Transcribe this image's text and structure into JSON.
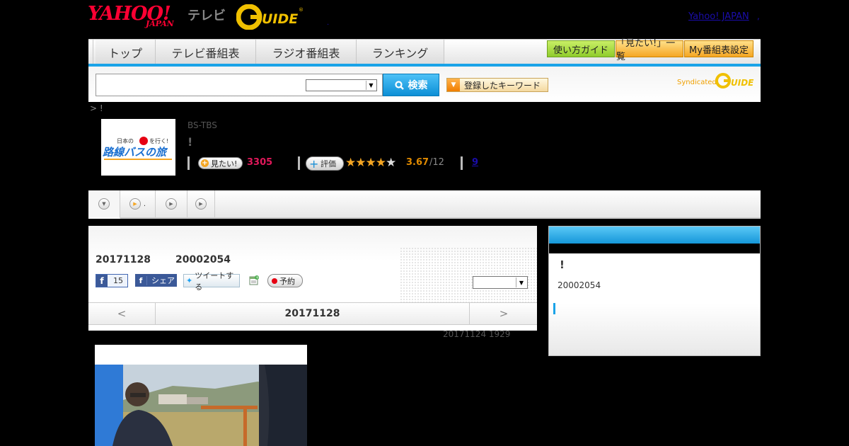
{
  "header": {
    "logo_yahoo": "YAHOO!",
    "logo_japan": "JAPAN",
    "logo_tv": "テレビ",
    "logo_gguide": "G GUIDE",
    "dot": ".",
    "yahoo_japan_link": "Yahoo! JAPAN",
    "link_dot": ","
  },
  "nav": {
    "tabs": [
      {
        "label": "トップ"
      },
      {
        "label": "テレビ番組表"
      },
      {
        "label": "ラジオ番組表"
      },
      {
        "label": "ランキング"
      }
    ],
    "utility": [
      {
        "label": "使い方ガイド"
      },
      {
        "label": "「見たい!」一覧"
      },
      {
        "label": "My番組表設定"
      }
    ]
  },
  "search": {
    "input_value": "",
    "select_value": "",
    "button_label": "検索",
    "keywords_label": "登録したキーワード",
    "syndicated_label": "Syndicated"
  },
  "breadcrumb": "> !",
  "program": {
    "thumb_small": "日本の",
    "thumb_big": "路線バスの旅",
    "thumb_mid": "を行く!",
    "channel": "BS-TBS",
    "title": "!",
    "mitai_label": "見たい!",
    "mitai_count": "3305",
    "hyoka_label": "評価",
    "rating_value": 3.67,
    "rating_display": "3.67",
    "rating_count": "/12",
    "review_count": "9"
  },
  "tabs_strip": {
    "items": [
      {
        "label": ""
      },
      {
        "label": "."
      },
      {
        "label": ""
      },
      {
        "label": ""
      }
    ]
  },
  "episode": {
    "date": "20171128",
    "id": "20002054",
    "fb_like_count": "15",
    "fb_share_label": "シェア",
    "tweet_label": "ツイートする",
    "yoyaku_label": "予約",
    "select_value": "",
    "prev_arrow": "<",
    "nav_date": "20171128",
    "next_arrow": ">",
    "updated": "20171124  1929"
  },
  "side": {
    "title": "!",
    "id": "20002054"
  },
  "colors": {
    "accent_blue": "#1aa3e8",
    "yahoo_red": "#ff0033",
    "mitai_pink": "#e0185a",
    "star_orange": "#f5a623"
  }
}
